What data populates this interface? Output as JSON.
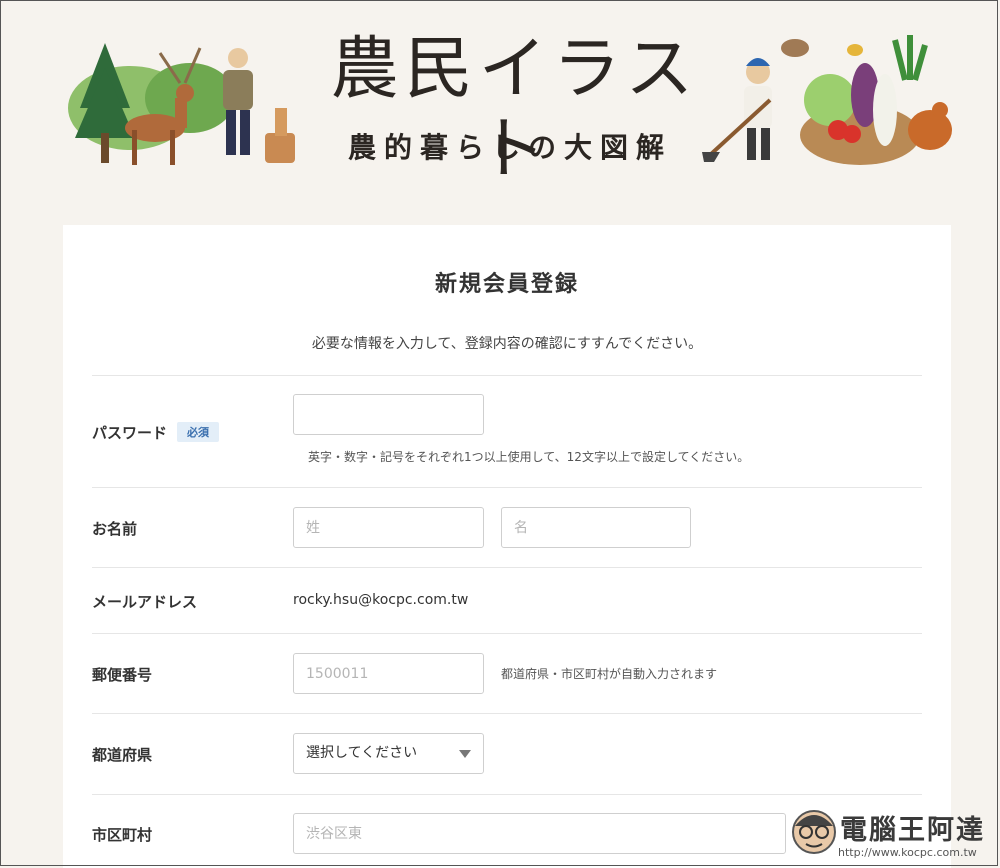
{
  "banner": {
    "title": "農民イラスト",
    "subtitle": "農的暮らしの大図解"
  },
  "form": {
    "title": "新規会員登録",
    "intro": "必要な情報を入力して、登録内容の確認にすすんでください。",
    "password": {
      "label": "パスワード",
      "badge": "必須",
      "value": "",
      "hint": "英字・数字・記号をそれぞれ1つ以上使用して、12文字以上で設定してください。"
    },
    "name": {
      "label": "お名前",
      "last_placeholder": "姓",
      "first_placeholder": "名"
    },
    "email": {
      "label": "メールアドレス",
      "value": "rocky.hsu@kocpc.com.tw"
    },
    "postal": {
      "label": "郵便番号",
      "placeholder": "1500011",
      "hint": "都道府県・市区町村が自動入力されます"
    },
    "prefecture": {
      "label": "都道府県",
      "selected": "選択してください"
    },
    "city": {
      "label": "市区町村",
      "placeholder": "渋谷区東"
    }
  },
  "watermark": {
    "brand": "電腦王阿達",
    "url": "http://www.kocpc.com.tw"
  },
  "colors": {
    "background": "#f6f3ee",
    "card": "#ffffff",
    "badge_bg": "#e3eef8",
    "badge_text": "#3a6fae"
  }
}
